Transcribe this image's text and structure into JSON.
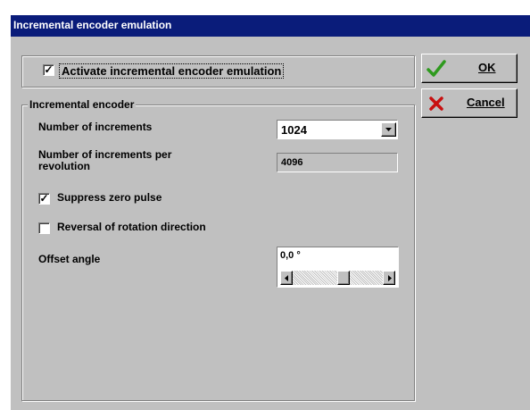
{
  "window": {
    "title": "Incremental encoder emulation"
  },
  "activate": {
    "label": "Activate incremental encoder emulation",
    "checked": true
  },
  "group": {
    "title": "Incremental encoder",
    "increments_label": "Number of increments",
    "increments_value": "1024",
    "per_rev_label_1": "Number of increments per",
    "per_rev_label_2": "revolution",
    "per_rev_value": "4096",
    "suppress_label": "Suppress zero pulse",
    "suppress_checked": true,
    "reversal_label": "Reversal of rotation direction",
    "reversal_checked": false,
    "offset_label": "Offset angle",
    "offset_value": "0,0 °"
  },
  "buttons": {
    "ok": "OK",
    "cancel": "Cancel"
  },
  "icons": {
    "ok": "checkmark-icon",
    "cancel": "red-x-icon",
    "dropdown": "dropdown-arrow-icon"
  },
  "colors": {
    "titlebar": "#0a1c7a",
    "ok_icon": "#2e9a1e",
    "cancel_icon": "#c81010"
  }
}
